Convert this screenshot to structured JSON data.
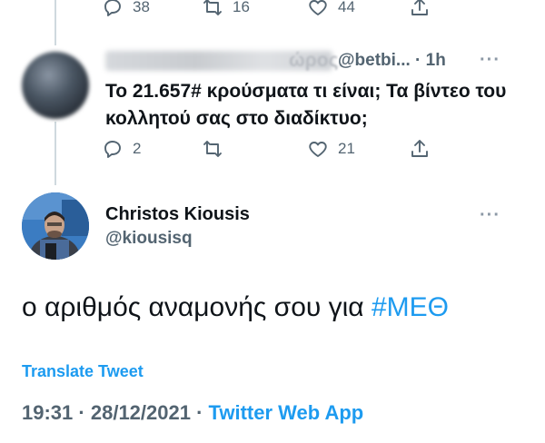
{
  "top_actions": {
    "reply_count": "38",
    "retweet_count": "16",
    "like_count": "44",
    "icons": [
      "reply-icon",
      "retweet-icon",
      "like-icon",
      "share-icon"
    ]
  },
  "reply_tweet": {
    "author_name_tail": "ώρος.",
    "handle": "@betbi...",
    "time": "1h",
    "text": "Το 21.657# κρούσματα τι είναι; Τα βίντεο του κολλητού σας στο διαδίκτυο;",
    "reply_count": "2",
    "retweet_count": "",
    "like_count": "21"
  },
  "main_tweet": {
    "author_name": "Christos Kiousis",
    "handle": "@kiousisq",
    "text_before": "ο αριθμός αναμονής σου για ",
    "hashtag": "#ΜΕΘ",
    "translate_label": "Translate Tweet",
    "time": "19:31",
    "date": "28/12/2021",
    "separator": "·",
    "source": "Twitter Web App"
  },
  "colors": {
    "accent": "#1d9bf0",
    "secondary_text": "#536471",
    "primary_text": "#0f1419",
    "thread_line": "#cfd9de"
  }
}
